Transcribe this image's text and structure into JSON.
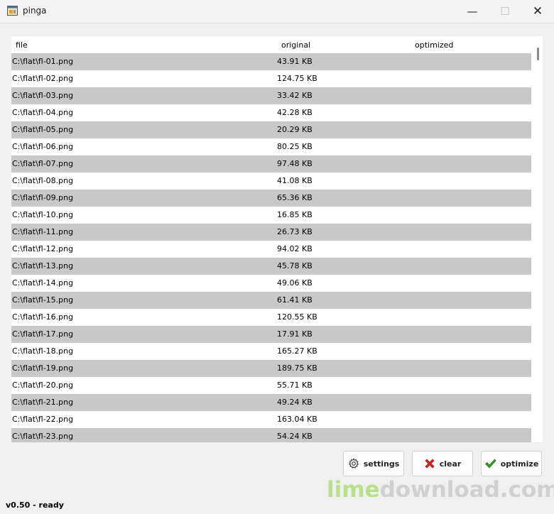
{
  "window": {
    "title": "pinga",
    "minimize_glyph": "—",
    "maximize_glyph": "☐",
    "close_glyph": "✕"
  },
  "list": {
    "columns": {
      "file": "file",
      "original": "original",
      "optimized": "optimized"
    },
    "rows": [
      {
        "file": "C:\\flat\\fl-01.png",
        "original": "43.91 KB",
        "optimized": ""
      },
      {
        "file": "C:\\flat\\fl-02.png",
        "original": "124.75 KB",
        "optimized": ""
      },
      {
        "file": "C:\\flat\\fl-03.png",
        "original": "33.42 KB",
        "optimized": ""
      },
      {
        "file": "C:\\flat\\fl-04.png",
        "original": "42.28 KB",
        "optimized": ""
      },
      {
        "file": "C:\\flat\\fl-05.png",
        "original": "20.29 KB",
        "optimized": ""
      },
      {
        "file": "C:\\flat\\fl-06.png",
        "original": "80.25 KB",
        "optimized": ""
      },
      {
        "file": "C:\\flat\\fl-07.png",
        "original": "97.48 KB",
        "optimized": ""
      },
      {
        "file": "C:\\flat\\fl-08.png",
        "original": "41.08 KB",
        "optimized": ""
      },
      {
        "file": "C:\\flat\\fl-09.png",
        "original": "65.36 KB",
        "optimized": ""
      },
      {
        "file": "C:\\flat\\fl-10.png",
        "original": "16.85 KB",
        "optimized": ""
      },
      {
        "file": "C:\\flat\\fl-11.png",
        "original": "26.73 KB",
        "optimized": ""
      },
      {
        "file": "C:\\flat\\fl-12.png",
        "original": "94.02 KB",
        "optimized": ""
      },
      {
        "file": "C:\\flat\\fl-13.png",
        "original": "45.78 KB",
        "optimized": ""
      },
      {
        "file": "C:\\flat\\fl-14.png",
        "original": "49.06 KB",
        "optimized": ""
      },
      {
        "file": "C:\\flat\\fl-15.png",
        "original": "61.41 KB",
        "optimized": ""
      },
      {
        "file": "C:\\flat\\fl-16.png",
        "original": "120.55 KB",
        "optimized": ""
      },
      {
        "file": "C:\\flat\\fl-17.png",
        "original": "17.91 KB",
        "optimized": ""
      },
      {
        "file": "C:\\flat\\fl-18.png",
        "original": "165.27 KB",
        "optimized": ""
      },
      {
        "file": "C:\\flat\\fl-19.png",
        "original": "189.75 KB",
        "optimized": ""
      },
      {
        "file": "C:\\flat\\fl-20.png",
        "original": "55.71 KB",
        "optimized": ""
      },
      {
        "file": "C:\\flat\\fl-21.png",
        "original": "49.24 KB",
        "optimized": ""
      },
      {
        "file": "C:\\flat\\fl-22.png",
        "original": "163.04 KB",
        "optimized": ""
      },
      {
        "file": "C:\\flat\\fl-23.png",
        "original": "54.24 KB",
        "optimized": ""
      }
    ]
  },
  "buttons": {
    "settings": {
      "label": "settings",
      "icon": "gear-icon"
    },
    "clear": {
      "label": "clear",
      "icon": "red-x-icon"
    },
    "optimize": {
      "label": "optimize",
      "icon": "green-check-icon"
    }
  },
  "status": {
    "text": "v0.50 - ready"
  },
  "watermark": {
    "part1": "lime",
    "part2": "download.com"
  },
  "colors": {
    "row_alt": "#c8c8c8",
    "clear_icon": "#d42a2a",
    "optimize_icon": "#3a9a2a",
    "watermark_lime": "#b9e08a",
    "watermark_gray": "#cfd0cf"
  }
}
